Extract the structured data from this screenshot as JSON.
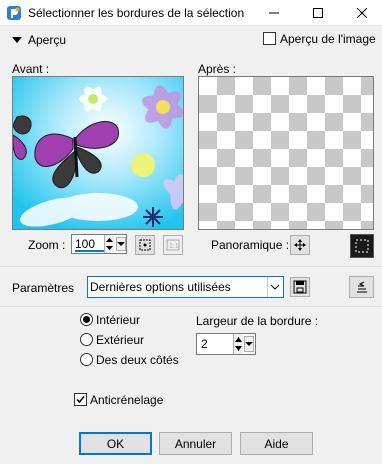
{
  "window": {
    "title": "Sélectionner les bordures de la sélection"
  },
  "preview_header": {
    "toggle_label": "Aperçu",
    "show_on_image_label": "Aperçu de l'image",
    "show_on_image_checked": false
  },
  "before": {
    "label": "Avant :"
  },
  "after": {
    "label": "Après :"
  },
  "zoom": {
    "label": "Zoom :",
    "value": "100"
  },
  "pan": {
    "label": "Panoramique :"
  },
  "presets": {
    "label": "Paramètres",
    "selected": "Dernières options utilisées"
  },
  "options": {
    "inside_label": "Intérieur",
    "outside_label": "Extérieur",
    "both_label": "Des deux côtés",
    "selected": "inside",
    "border_width_label": "Largeur de la bordure :",
    "border_width_value": "2",
    "antialias_label": "Anticrénelage",
    "antialias_checked": true
  },
  "buttons": {
    "ok": "OK",
    "cancel": "Annuler",
    "help": "Aide"
  },
  "colors": {
    "accent": "#0078d7",
    "cyan": "#2fd0f0",
    "butterfly_purple": "#a040b0"
  }
}
